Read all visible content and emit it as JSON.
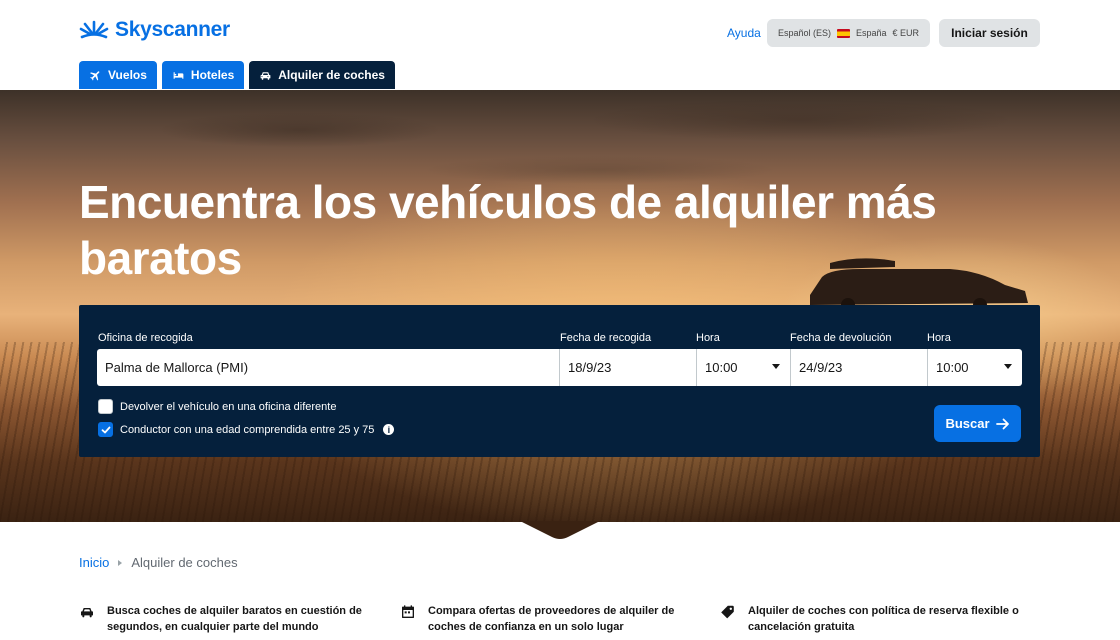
{
  "header": {
    "logo_text": "Skyscanner",
    "help_label": "Ayuda",
    "locale": {
      "language": "Español (ES)",
      "country": "España",
      "currency": "€ EUR"
    },
    "login_label": "Iniciar sesión"
  },
  "tabs": [
    {
      "label": "Vuelos",
      "icon": "plane-icon",
      "active": false
    },
    {
      "label": "Hoteles",
      "icon": "bed-icon",
      "active": false
    },
    {
      "label": "Alquiler de coches",
      "icon": "car-icon",
      "active": true
    }
  ],
  "hero": {
    "title": "Encuentra los vehículos de alquiler más baratos"
  },
  "search": {
    "pickup_office_label": "Oficina de recogida",
    "pickup_office_value": "Palma de Mallorca (PMI)",
    "pickup_date_label": "Fecha de recogida",
    "pickup_date_value": "18/9/23",
    "pickup_time_label": "Hora",
    "pickup_time_value": "10:00",
    "return_date_label": "Fecha de devolución",
    "return_date_value": "24/9/23",
    "return_time_label": "Hora",
    "return_time_value": "10:00",
    "different_office_label": "Devolver el vehículo en una oficina diferente",
    "different_office_checked": false,
    "driver_age_label": "Conductor con una edad comprendida entre 25 y 75",
    "driver_age_checked": true,
    "search_label": "Buscar"
  },
  "breadcrumb": {
    "home": "Inicio",
    "current": "Alquiler de coches"
  },
  "features": [
    {
      "icon": "car-icon",
      "text": "Busca coches de alquiler baratos en cuestión de segundos, en cualquier parte del mundo"
    },
    {
      "icon": "calendar-icon",
      "text": "Compara ofertas de proveedores de alquiler de coches de confianza en un solo lugar"
    },
    {
      "icon": "tag-icon",
      "text": "Alquiler de coches con política de reserva flexible o cancelación gratuita"
    }
  ],
  "colors": {
    "brand_blue": "#0770e3",
    "dark_navy": "#05203c",
    "button_grey": "#e0e3e5"
  }
}
